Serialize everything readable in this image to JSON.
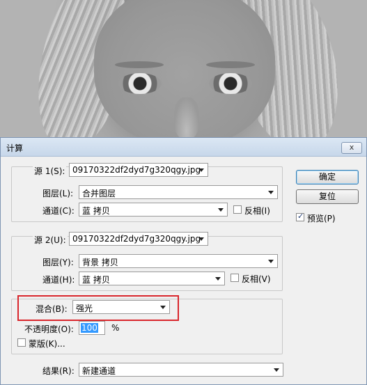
{
  "dialog": {
    "title": "计算",
    "close_label": "x"
  },
  "source1": {
    "label": "源 1(S):",
    "file": "09170322df2dyd7g320qgy.jpg",
    "layer_label": "图层(L):",
    "layer_value": "合并图层",
    "channel_label": "通道(C):",
    "channel_value": "蓝 拷贝",
    "invert_label": "反相(I)",
    "invert_checked": false
  },
  "source2": {
    "label": "源 2(U):",
    "file": "09170322df2dyd7g320qgy.jpg",
    "layer_label": "图层(Y):",
    "layer_value": "背景 拷贝",
    "channel_label": "通道(H):",
    "channel_value": "蓝 拷贝",
    "invert_label": "反相(V)",
    "invert_checked": false
  },
  "blend": {
    "label": "混合(B):",
    "mode": "强光",
    "opacity_label": "不透明度(O):",
    "opacity_value": "100",
    "opacity_unit": "%",
    "mask_label": "蒙版(K)...",
    "mask_checked": false
  },
  "result": {
    "label": "结果(R):",
    "value": "新建通道"
  },
  "buttons": {
    "ok": "确定",
    "reset": "复位"
  },
  "preview": {
    "label": "预览(P)",
    "checked": true
  },
  "colors": {
    "highlight": "#d9262c",
    "selection": "#3399ff"
  }
}
